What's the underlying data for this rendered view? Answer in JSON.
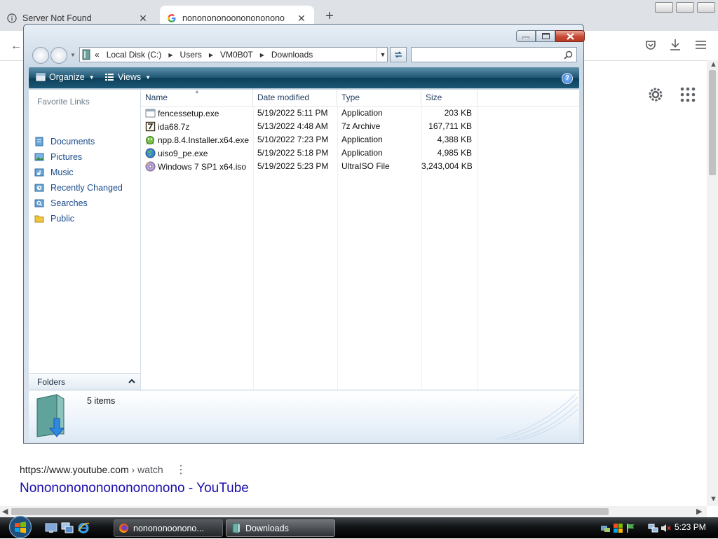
{
  "browser": {
    "tabs": [
      {
        "label": "Server Not Found",
        "icon": "info-icon",
        "active": false
      },
      {
        "label": "nononononoononononono",
        "icon": "google-icon",
        "active": true
      }
    ],
    "toolbar_icons": [
      "back-arrow-icon",
      "pocket-icon",
      "download-icon",
      "menu-icon"
    ]
  },
  "page": {
    "result_url_domain": "https://www.youtube.com",
    "result_url_path": " › watch",
    "result_title": "Nonononononononononono - YouTube"
  },
  "explorer": {
    "breadcrumb_prefix": "«",
    "breadcrumbs": [
      "Local Disk (C:)",
      "Users",
      "VM0B0T",
      "Downloads"
    ],
    "search": {
      "value": "",
      "placeholder": ""
    },
    "commands": {
      "organize": "Organize",
      "views": "Views",
      "help": "?"
    },
    "favorite_links_title": "Favorite Links",
    "favorite_links": [
      {
        "label": "Documents",
        "icon": "documents-icon"
      },
      {
        "label": "Pictures",
        "icon": "pictures-icon"
      },
      {
        "label": "Music",
        "icon": "music-icon"
      },
      {
        "label": "Recently Changed",
        "icon": "recently-changed-icon"
      },
      {
        "label": "Searches",
        "icon": "searches-icon"
      },
      {
        "label": "Public",
        "icon": "public-folder-icon"
      }
    ],
    "folders_label": "Folders",
    "columns": [
      "Name",
      "Date modified",
      "Type",
      "Size"
    ],
    "files": [
      {
        "name": "fencessetup.exe",
        "date": "5/19/2022 5:11 PM",
        "type": "Application",
        "size": "203 KB",
        "icon": "exe-icon"
      },
      {
        "name": "ida68.7z",
        "date": "5/13/2022 4:48 AM",
        "type": "7z Archive",
        "size": "167,711 KB",
        "icon": "archive-icon"
      },
      {
        "name": "npp.8.4.Installer.x64.exe",
        "date": "5/10/2022 7:23 PM",
        "type": "Application",
        "size": "4,388 KB",
        "icon": "notepadpp-icon"
      },
      {
        "name": "uiso9_pe.exe",
        "date": "5/19/2022 5:18 PM",
        "type": "Application",
        "size": "4,985 KB",
        "icon": "globe-icon"
      },
      {
        "name": "Windows 7 SP1 x64.iso",
        "date": "5/19/2022 5:23 PM",
        "type": "UltraISO File",
        "size": "3,243,004 KB",
        "icon": "disc-icon"
      }
    ],
    "item_count": "5 items"
  },
  "taskbar": {
    "buttons": [
      {
        "label": "nonononoonono...",
        "icon": "firefox-icon",
        "active": false
      },
      {
        "label": "Downloads",
        "icon": "folder-icon",
        "active": true
      }
    ],
    "clock": "5:23 PM"
  },
  "colors": {
    "link": "#1a0dab",
    "command_bar": "#1c5572",
    "nav_link": "#1a4b8c",
    "close_button": "#c84a34"
  }
}
